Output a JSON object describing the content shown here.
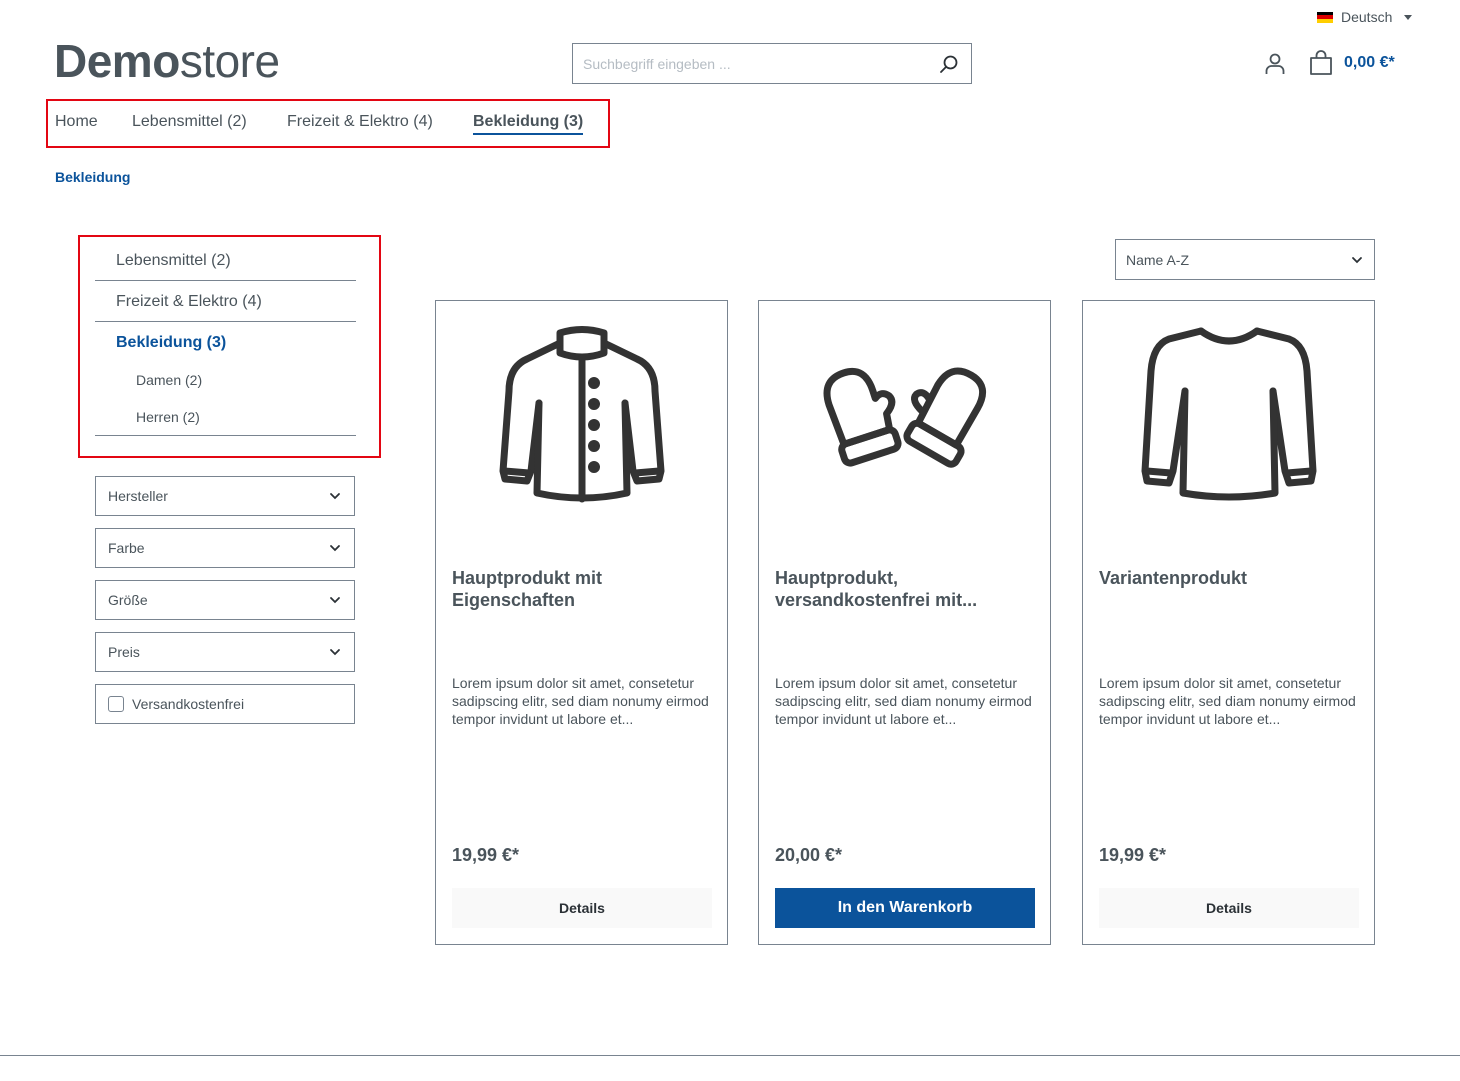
{
  "header": {
    "language": "Deutsch",
    "logo_bold": "Demo",
    "logo_light": "store",
    "search_placeholder": "Suchbegriff eingeben ...",
    "cart_total": "0,00 €*"
  },
  "main_nav": {
    "items": [
      {
        "label": "Home"
      },
      {
        "label": "Lebensmittel (2)"
      },
      {
        "label": "Freizeit & Elektro (4)"
      },
      {
        "label": "Bekleidung (3)",
        "active": true
      }
    ]
  },
  "breadcrumb": "Bekleidung",
  "category_nav": {
    "items": [
      {
        "label": "Lebensmittel (2)"
      },
      {
        "label": "Freizeit & Elektro (4)"
      },
      {
        "label": "Bekleidung (3)",
        "active": true
      }
    ],
    "subitems": [
      {
        "label": "Damen (2)"
      },
      {
        "label": "Herren (2)"
      }
    ]
  },
  "filters": {
    "manufacturer": "Hersteller",
    "color": "Farbe",
    "size": "Größe",
    "price": "Preis",
    "free_shipping": "Versandkostenfrei"
  },
  "sorting": {
    "selected": "Name A-Z"
  },
  "products": [
    {
      "name": "Hauptprodukt mit Eigenschaften",
      "description": "Lorem ipsum dolor sit amet, consetetur sadipscing elitr, sed diam nonumy eirmod tempor invidunt ut labore et...",
      "price": "19,99 €*",
      "button": "Details",
      "icon": "jacket-icon"
    },
    {
      "name": "Hauptprodukt, versandkostenfrei mit...",
      "description": "Lorem ipsum dolor sit amet, consetetur sadipscing elitr, sed diam nonumy eirmod tempor invidunt ut labore et...",
      "price": "20,00 €*",
      "button": "In den Warenkorb",
      "icon": "mittens-icon"
    },
    {
      "name": "Variantenprodukt",
      "description": "Lorem ipsum dolor sit amet, consetetur sadipscing elitr, sed diam nonumy eirmod tempor invidunt ut labore et...",
      "price": "19,99 €*",
      "button": "Details",
      "icon": "sweater-icon"
    }
  ],
  "colors": {
    "primary": "#0b539b",
    "text": "#4a545b",
    "border": "#798490",
    "highlight": "#e30613"
  }
}
